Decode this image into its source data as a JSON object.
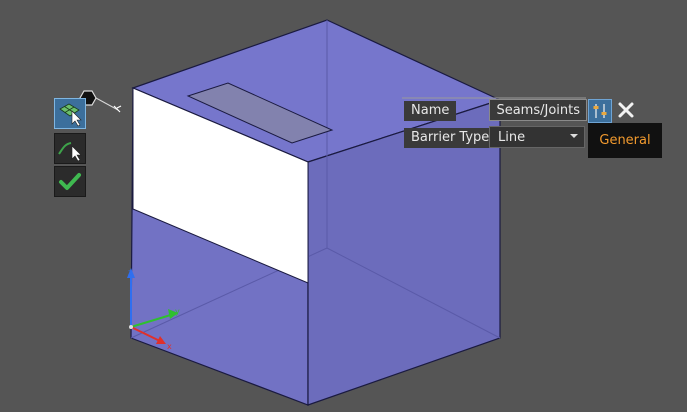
{
  "toolbar": {
    "tools": [
      {
        "icon": "surface-select-icon",
        "active": true
      },
      {
        "icon": "line-select-icon",
        "active": false
      },
      {
        "icon": "checkmark-icon",
        "active": false
      }
    ]
  },
  "properties": {
    "name_label": "Name",
    "name_value": "Seams/Joints",
    "barrier_type_label": "Barrier Type",
    "barrier_type_value": "Line"
  },
  "tooltip": {
    "text": "General"
  },
  "colors": {
    "background": "#555555",
    "cube_fill": "#7070c6",
    "selected_face": "#ffffff",
    "accent": "#3c6f9c",
    "tooltip_text": "#f29a2e",
    "axis_x": "#e0302a",
    "axis_y": "#2fc02f",
    "axis_z": "#2f6ff0"
  }
}
